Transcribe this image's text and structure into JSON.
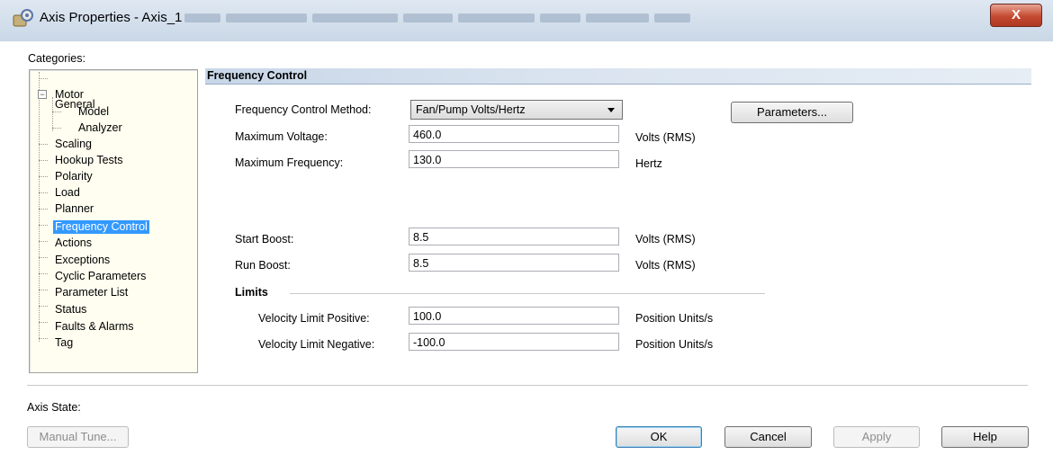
{
  "window": {
    "title": "Axis Properties - Axis_1",
    "close_glyph": "X",
    "icon": "axis-properties-icon"
  },
  "categories": {
    "label": "Categories:",
    "items": [
      {
        "label": "General"
      },
      {
        "label": "Motor"
      },
      {
        "label": "Model"
      },
      {
        "label": "Analyzer"
      },
      {
        "label": "Scaling"
      },
      {
        "label": "Hookup Tests"
      },
      {
        "label": "Polarity"
      },
      {
        "label": "Load"
      },
      {
        "label": "Planner"
      },
      {
        "label": "Frequency Control"
      },
      {
        "label": "Actions"
      },
      {
        "label": "Exceptions"
      },
      {
        "label": "Cyclic Parameters"
      },
      {
        "label": "Parameter List"
      },
      {
        "label": "Status"
      },
      {
        "label": "Faults & Alarms"
      },
      {
        "label": "Tag"
      }
    ],
    "selected": "Frequency Control"
  },
  "section": {
    "title": "Frequency Control",
    "method_label": "Frequency Control Method:",
    "method_value": "Fan/Pump Volts/Hertz",
    "parameters_button": "Parameters...",
    "max_voltage_label": "Maximum Voltage:",
    "max_voltage_value": "460.0",
    "max_voltage_unit": "Volts (RMS)",
    "max_freq_label": "Maximum Frequency:",
    "max_freq_value": "130.0",
    "max_freq_unit": "Hertz",
    "start_boost_label": "Start Boost:",
    "start_boost_value": "8.5",
    "start_boost_unit": "Volts (RMS)",
    "run_boost_label": "Run Boost:",
    "run_boost_value": "8.5",
    "run_boost_unit": "Volts (RMS)",
    "limits_label": "Limits",
    "vel_pos_label": "Velocity Limit Positive:",
    "vel_pos_value": "100.0",
    "vel_pos_unit": "Position Units/s",
    "vel_neg_label": "Velocity Limit Negative:",
    "vel_neg_value": "-100.0",
    "vel_neg_unit": "Position Units/s"
  },
  "footer": {
    "axis_state_label": "Axis State:",
    "manual_tune": "Manual Tune...",
    "ok": "OK",
    "cancel": "Cancel",
    "apply": "Apply",
    "help": "Help"
  },
  "colors": {
    "selection": "#3399ff",
    "header_band": "#c8d6e8",
    "close_button": "#c44a31"
  }
}
